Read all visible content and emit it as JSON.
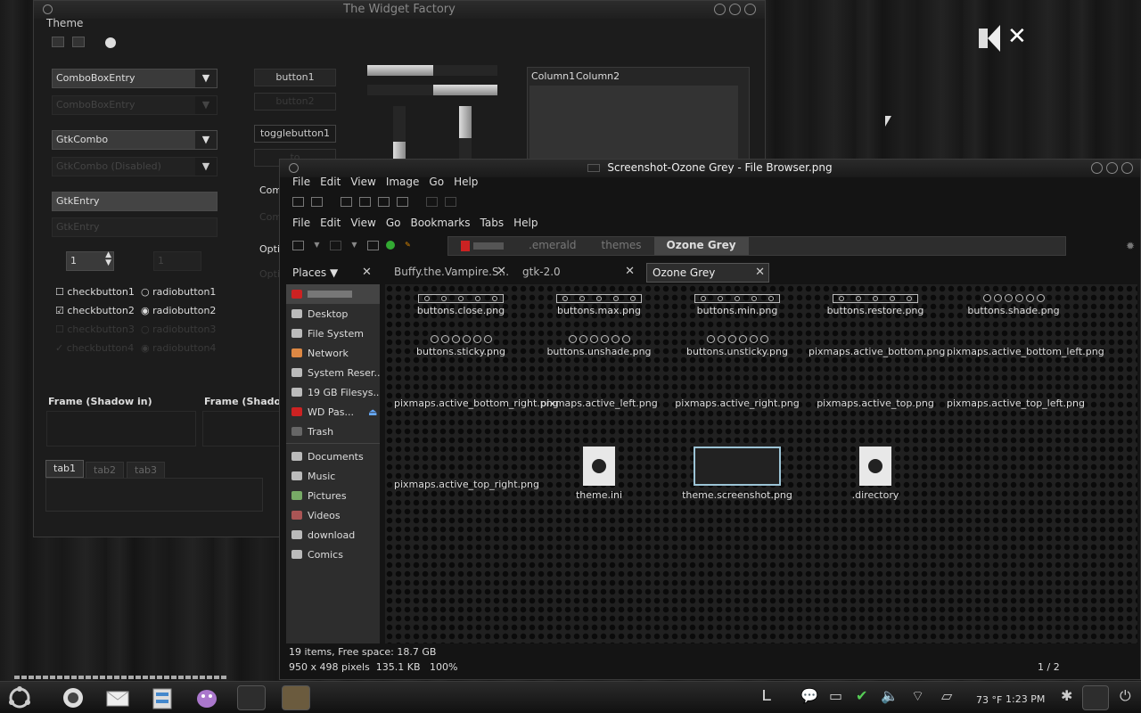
{
  "widget_factory": {
    "title": "The Widget Factory",
    "menu_theme": "Theme",
    "combo_entry": "ComboBoxEntry",
    "combo_entry_disabled": "ComboBoxEntry",
    "gtk_combo": "GtkCombo",
    "gtk_combo_disabled": "GtkCombo (Disabled)",
    "gtk_entry": "GtkEntry",
    "gtk_entry_disabled": "GtkEntry",
    "spin_value": "1",
    "spin_value_disabled": "1",
    "check1": "checkbutton1",
    "check2": "checkbutton2",
    "check3": "checkbutton3",
    "check4": "checkbutton4",
    "radio1": "radiobutton1",
    "radio2": "radiobutton2",
    "radio3": "radiobutton3",
    "radio4": "radiobutton4",
    "button1": "button1",
    "button2": "button2",
    "togglebutton1": "togglebutton1",
    "togglebutton2": "to",
    "combo_partial": "Com",
    "combo_partial_dis": "Com",
    "option_partial": "Opti",
    "option_partial_dis": "Opti",
    "tree_col1": "Column1",
    "tree_col2": "Column2",
    "frame_in": "Frame (Shadow in)",
    "frame_out": "Frame (Shadow",
    "tabs": [
      "tab1",
      "tab2",
      "tab3"
    ]
  },
  "file_browser": {
    "title": "Screenshot-Ozone Grey - File Browser.png",
    "viewer_menu": [
      "File",
      "Edit",
      "View",
      "Image",
      "Go",
      "Help"
    ],
    "fm_menu": [
      "File",
      "Edit",
      "View",
      "Go",
      "Bookmarks",
      "Tabs",
      "Help"
    ],
    "path": [
      ".emerald",
      "themes",
      "Ozone Grey"
    ],
    "places_label": "Places ▼",
    "places": [
      "Desktop",
      "File System",
      "Network",
      "System Reser...",
      "19 GB Filesys...",
      "WD Pas...",
      "Trash"
    ],
    "bookmarks": [
      "Documents",
      "Music",
      "Pictures",
      "Videos",
      "download",
      "Comics"
    ],
    "tabs": [
      "Buffy.the.Vampire.S...",
      "gtk-2.0",
      "Ozone Grey"
    ],
    "files": [
      {
        "name": "buttons.close.png"
      },
      {
        "name": "buttons.max.png"
      },
      {
        "name": "buttons.min.png"
      },
      {
        "name": "buttons.restore.png"
      },
      {
        "name": "buttons.shade.png"
      },
      {
        "name": "buttons.sticky.png"
      },
      {
        "name": "buttons.unshade.png"
      },
      {
        "name": "buttons.unsticky.png"
      },
      {
        "name": "pixmaps.active_bottom.png"
      },
      {
        "name": "pixmaps.active_bottom_left.png"
      },
      {
        "name": "pixmaps.active_bottom_right.png"
      },
      {
        "name": "pixmaps.active_left.png"
      },
      {
        "name": "pixmaps.active_right.png"
      },
      {
        "name": "pixmaps.active_top.png"
      },
      {
        "name": "pixmaps.active_top_left.png"
      },
      {
        "name": "pixmaps.active_top_right.png"
      },
      {
        "name": "theme.ini"
      },
      {
        "name": "theme.screenshot.png"
      },
      {
        "name": ".directory"
      }
    ],
    "status_items": "19 items, Free space: 18.7 GB",
    "image_info": "950 x 498 pixels  135.1 KB   100%",
    "page": "1 / 2"
  },
  "taskbar": {
    "temperature": "73 °F",
    "time": "1:23 PM"
  }
}
